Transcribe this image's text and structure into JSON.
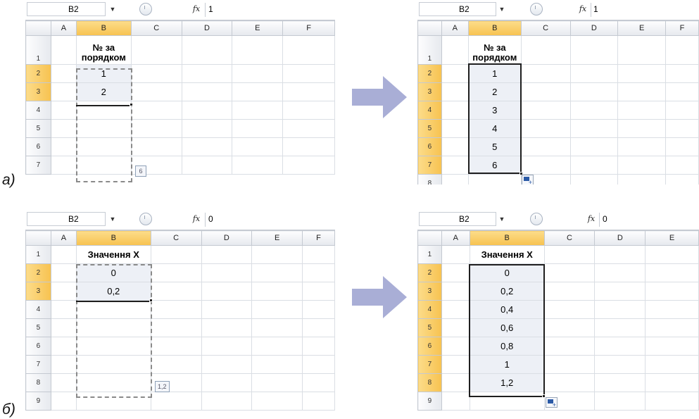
{
  "columns": [
    "A",
    "B",
    "C",
    "D",
    "E",
    "F"
  ],
  "examples": [
    {
      "label": "а)",
      "before": {
        "name_box": "B2",
        "formula": "1",
        "header": "№ за порядком",
        "row_numbers": [
          "1",
          "2",
          "3",
          "4",
          "5",
          "6",
          "7"
        ],
        "values": [
          "1",
          "2"
        ],
        "tooltip": "6"
      },
      "after": {
        "name_box": "B2",
        "formula": "1",
        "header": "№ за порядком",
        "row_numbers": [
          "1",
          "2",
          "3",
          "4",
          "5",
          "6",
          "7",
          "8"
        ],
        "values": [
          "1",
          "2",
          "3",
          "4",
          "5",
          "6"
        ]
      }
    },
    {
      "label": "б)",
      "before": {
        "name_box": "B2",
        "formula": "0",
        "header": "Значення Х",
        "row_numbers": [
          "1",
          "2",
          "3",
          "4",
          "5",
          "6",
          "7",
          "8",
          "9"
        ],
        "values": [
          "0",
          "0,2"
        ],
        "tooltip": "1,2"
      },
      "after": {
        "name_box": "B2",
        "formula": "0",
        "header": "Значення Х",
        "row_numbers": [
          "1",
          "2",
          "3",
          "4",
          "5",
          "6",
          "7",
          "8",
          "9"
        ],
        "values": [
          "0",
          "0,2",
          "0,4",
          "0,6",
          "0,8",
          "1",
          "1,2"
        ]
      }
    }
  ],
  "icons": {
    "fx": "fx-icon",
    "dropdown": "chevron-down-icon",
    "arrow": "right-arrow-icon",
    "autofill": "auto-fill-options-icon"
  },
  "colors": {
    "header_selected": "#f8c860",
    "cell_fill": "#edf0f6",
    "arrow": "#a9aed6"
  }
}
